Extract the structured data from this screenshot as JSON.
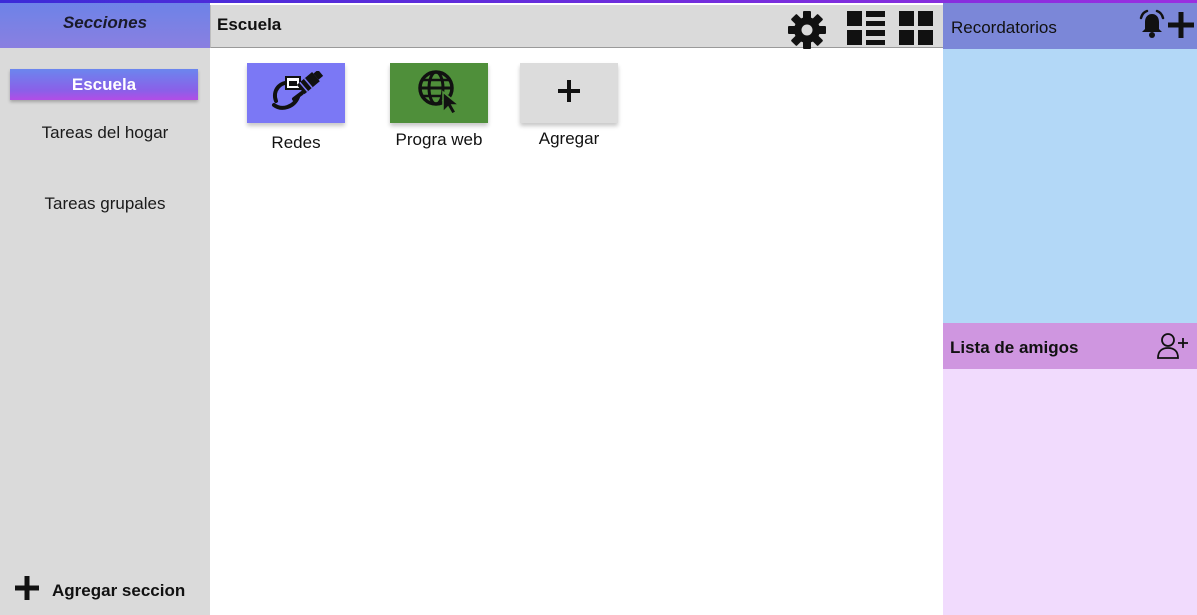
{
  "sidebar": {
    "title": "Secciones",
    "items": [
      {
        "label": "Escuela",
        "active": true
      },
      {
        "label": "Tareas del hogar",
        "active": false
      },
      {
        "label": "Tareas grupales",
        "active": false
      }
    ],
    "add_label": "Agregar seccion",
    "add_icon": "plus-icon"
  },
  "main": {
    "title": "Escuela",
    "toolbar_icons": [
      "gear-icon",
      "list-view-icon",
      "grid-view-icon"
    ],
    "cards": [
      {
        "label": "Redes",
        "icon": "network-cable-icon",
        "color": "#7b78f5"
      },
      {
        "label": "Progra web",
        "icon": "globe-cursor-icon",
        "color": "#4f8f3a"
      },
      {
        "label": "Agregar",
        "icon": "plus-icon",
        "color": "#dcdcdc"
      }
    ]
  },
  "reminders": {
    "title": "Recordatorios",
    "icons": [
      "alarm-bell-icon",
      "plus-icon"
    ]
  },
  "friends": {
    "title": "Lista de amigos",
    "icon": "add-user-icon"
  },
  "colors": {
    "sidebar_bg": "#dadada",
    "reminders_header": "#7b87d8",
    "reminders_body": "#b3d8f7",
    "friends_header": "#cf96e0",
    "friends_body": "#f1dbfd"
  }
}
